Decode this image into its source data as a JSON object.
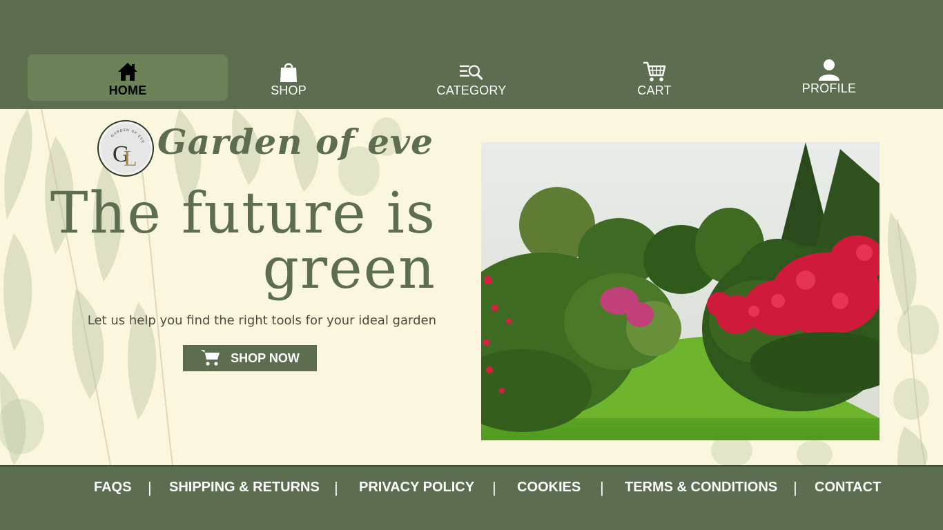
{
  "nav": {
    "items": [
      {
        "label": "HOME",
        "icon": "home-icon",
        "active": true
      },
      {
        "label": "SHOP",
        "icon": "shopping-bag-icon",
        "active": false
      },
      {
        "label": "CATEGORY",
        "icon": "category-search-icon",
        "active": false
      },
      {
        "label": "CART",
        "icon": "cart-icon",
        "active": false
      },
      {
        "label": "PROFILE",
        "icon": "user-icon",
        "active": false
      }
    ]
  },
  "hero": {
    "logo_ring_text": "GARDEN OF EVE",
    "logo_monogram": "GE",
    "brand_name": "Garden of eve",
    "headline_line1": "The future is",
    "headline_line2": "green",
    "subtitle": "Let us help you find the right tools for your ideal garden",
    "cta_label": "SHOP NOW",
    "cta_icon": "cart-icon"
  },
  "footer": {
    "links": [
      "FAQS",
      "SHIPPING & RETURNS",
      "PRIVACY POLICY",
      "COOKIES",
      "TERMS & CONDITIONS",
      "CONTACT"
    ],
    "separator": "|"
  },
  "colors": {
    "primary_green": "#5c6e4f",
    "active_tab": "#6e8258",
    "cream": "#fbf6de",
    "white": "#ffffff"
  }
}
